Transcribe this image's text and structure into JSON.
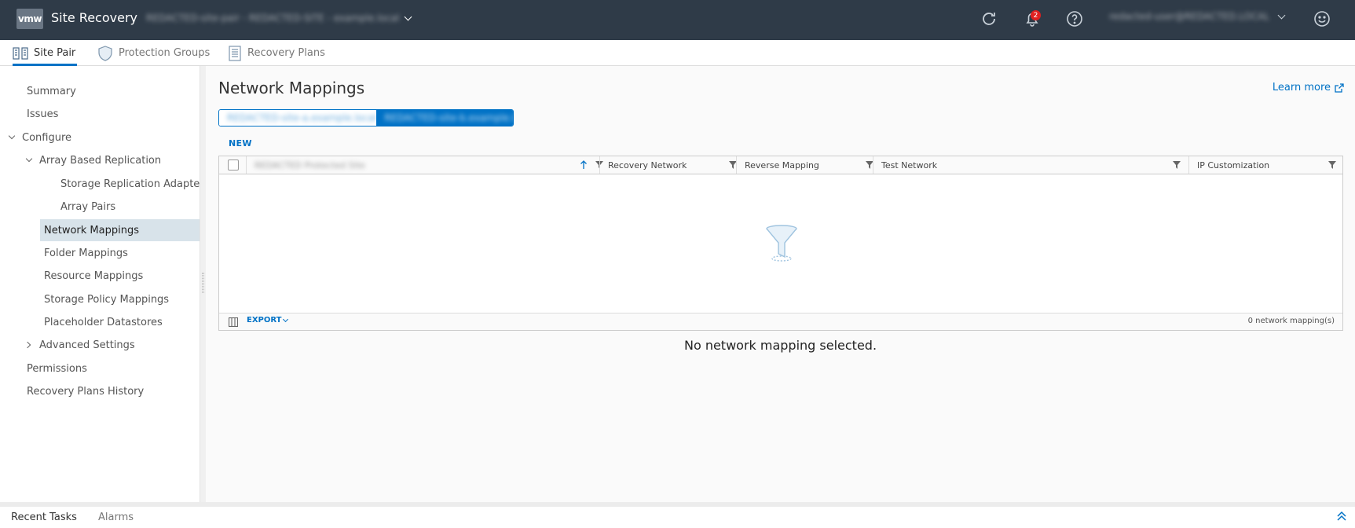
{
  "header": {
    "logo": "vmw",
    "title": "Site Recovery",
    "site_context": "REDACTED-site-pair - REDACTED-SITE - example.local",
    "notifications_count": "2",
    "user": "redacted-user@REDACTED.LOCAL"
  },
  "tabs": [
    {
      "label": "Site Pair"
    },
    {
      "label": "Protection Groups"
    },
    {
      "label": "Recovery Plans"
    }
  ],
  "sidebar": {
    "summary": "Summary",
    "issues": "Issues",
    "configure": "Configure",
    "array_based_replication": "Array Based Replication",
    "storage_replication_adapters": "Storage Replication Adapte...",
    "array_pairs": "Array Pairs",
    "network_mappings": "Network Mappings",
    "folder_mappings": "Folder Mappings",
    "resource_mappings": "Resource Mappings",
    "storage_policy_mappings": "Storage Policy Mappings",
    "placeholder_datastores": "Placeholder Datastores",
    "advanced_settings": "Advanced Settings",
    "permissions": "Permissions",
    "recovery_plans_history": "Recovery Plans History"
  },
  "main": {
    "title": "Network Mappings",
    "learn_more": "Learn more",
    "toggle_left": "REDACTED-site-a.example.local",
    "toggle_right": "REDACTED-site-b.example.local",
    "new_label": "NEW",
    "columns": {
      "first": "REDACTED Protected Site",
      "recovery_network": "Recovery Network",
      "reverse_mapping": "Reverse Mapping",
      "test_network": "Test Network",
      "ip_customization": "IP Customization"
    },
    "export_label": "EXPORT",
    "count_label": "0 network mapping(s)",
    "no_selection": "No network mapping selected."
  },
  "bottom": {
    "recent_tasks": "Recent Tasks",
    "alarms": "Alarms"
  },
  "colors": {
    "header_bg": "#2f3b48",
    "accent": "#0072c6",
    "selected_bg": "#d8e3ea",
    "badge": "#e02020"
  }
}
